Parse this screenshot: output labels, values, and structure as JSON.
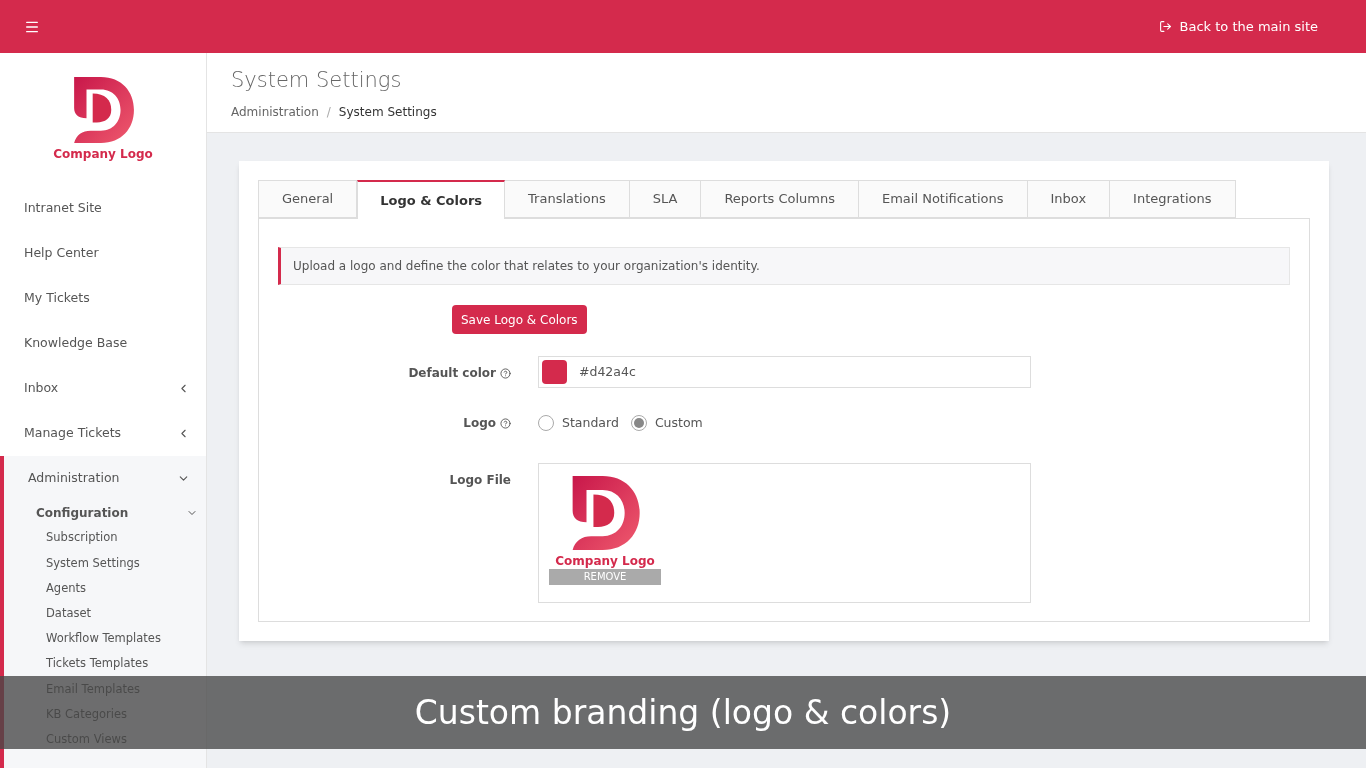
{
  "topbar": {
    "back_link": "Back to the main site"
  },
  "sidebar": {
    "logo_text": "Company Logo",
    "items": [
      {
        "label": "Intranet Site",
        "has_arrow": false
      },
      {
        "label": "Help Center",
        "has_arrow": false
      },
      {
        "label": "My Tickets",
        "has_arrow": false
      },
      {
        "label": "Knowledge Base",
        "has_arrow": false
      },
      {
        "label": "Inbox",
        "has_arrow": true
      },
      {
        "label": "Manage Tickets",
        "has_arrow": true
      }
    ],
    "section": {
      "label": "Administration",
      "expanded": true,
      "group": {
        "label": "Configuration",
        "expanded": true,
        "children": [
          {
            "label": "Subscription"
          },
          {
            "label": "System Settings"
          },
          {
            "label": "Agents"
          },
          {
            "label": "Dataset"
          },
          {
            "label": "Workflow Templates"
          },
          {
            "label": "Tickets Templates"
          },
          {
            "label": "Email Templates"
          },
          {
            "label": "KB Categories"
          },
          {
            "label": "Custom Views"
          }
        ]
      }
    }
  },
  "page": {
    "title": "System Settings",
    "breadcrumb_separator": "/",
    "breadcrumb": [
      {
        "label": "Administration"
      },
      {
        "label": "System Settings"
      }
    ]
  },
  "tabs": [
    {
      "label": "General",
      "selected": false
    },
    {
      "label": "Logo & Colors",
      "selected": true
    },
    {
      "label": "Translations",
      "selected": false
    },
    {
      "label": "SLA",
      "selected": false
    },
    {
      "label": "Reports Columns",
      "selected": false
    },
    {
      "label": "Email Notifications",
      "selected": false
    },
    {
      "label": "Inbox",
      "selected": false
    },
    {
      "label": "Integrations",
      "selected": false
    }
  ],
  "notice": "Upload a logo and define the color that relates to your organization's identity.",
  "save_button": "Save Logo & Colors",
  "default_color": {
    "label": "Default color",
    "color": "#d42a4c",
    "value": "#d42a4c"
  },
  "logo_option": {
    "label": "Logo",
    "options": [
      {
        "label": "Standard",
        "selected": false
      },
      {
        "label": "Custom",
        "selected": true
      }
    ]
  },
  "logo_file": {
    "label": "Logo File",
    "logo_text": "Company Logo",
    "remove_button": "REMOVE"
  },
  "caption": "Custom branding (logo & colors)"
}
